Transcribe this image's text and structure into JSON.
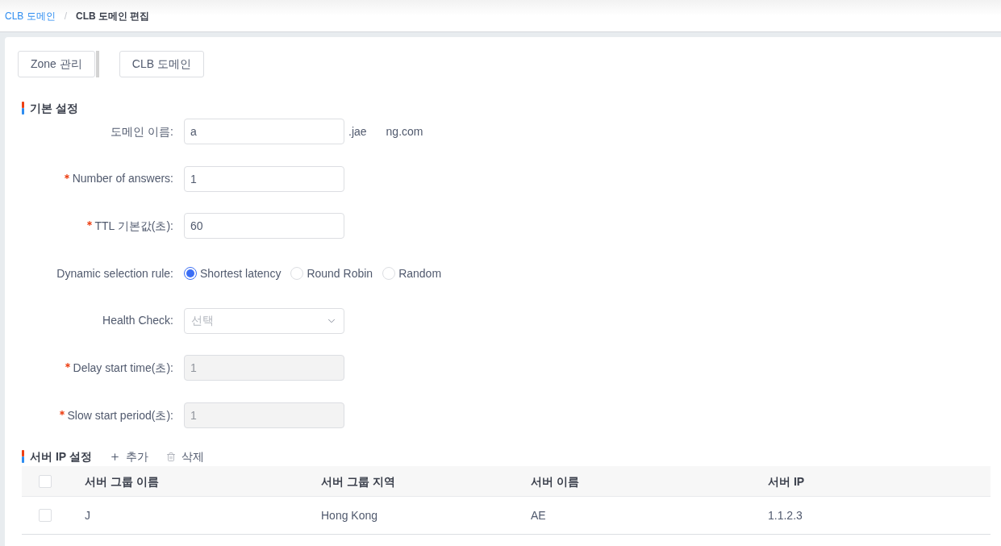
{
  "breadcrumb": {
    "items": [
      {
        "label": "CLB 도메인",
        "link": true
      },
      {
        "label": "CLB 도메인 편집",
        "link": false
      }
    ],
    "separator": "/"
  },
  "nav_buttons": [
    "Zone 관리",
    "CLB 도메인"
  ],
  "basic_settings": {
    "title": "기본 설정",
    "fields": [
      {
        "kind": "input",
        "label": "도메인 이름:",
        "required": false,
        "value": "a",
        "disabled": false,
        "suffix": [
          ".jae",
          "ng.com"
        ]
      },
      {
        "kind": "input",
        "label": "Number of answers:",
        "required": true,
        "value": "1",
        "disabled": false
      },
      {
        "kind": "input",
        "label": "TTL 기본값(초):",
        "required": true,
        "value": "60",
        "disabled": false
      },
      {
        "kind": "radio",
        "label": "Dynamic selection rule:",
        "required": false,
        "options": [
          {
            "label": "Shortest latency",
            "selected": true
          },
          {
            "label": "Round Robin",
            "selected": false
          },
          {
            "label": "Random",
            "selected": false
          }
        ]
      },
      {
        "kind": "select",
        "label": "Health Check:",
        "required": false,
        "placeholder": "선택"
      },
      {
        "kind": "input",
        "label": "Delay start time(초):",
        "required": true,
        "value": "1",
        "disabled": true
      },
      {
        "kind": "input",
        "label": "Slow start period(초):",
        "required": true,
        "value": "1",
        "disabled": true
      }
    ]
  },
  "server_ip_settings": {
    "title": "서버 IP 설정",
    "actions": [
      {
        "kind": "add",
        "label": "추가"
      },
      {
        "kind": "delete",
        "label": "삭제"
      }
    ],
    "table": {
      "select_all_checked": false,
      "columns": [
        "서버 그룹 이름",
        "서버 그룹 지역",
        "서버 이름",
        "서버 IP"
      ],
      "rows": [
        {
          "checked": false,
          "cells": [
            "J",
            "Hong Kong",
            "AE",
            "1.1.2.3"
          ]
        }
      ]
    }
  }
}
